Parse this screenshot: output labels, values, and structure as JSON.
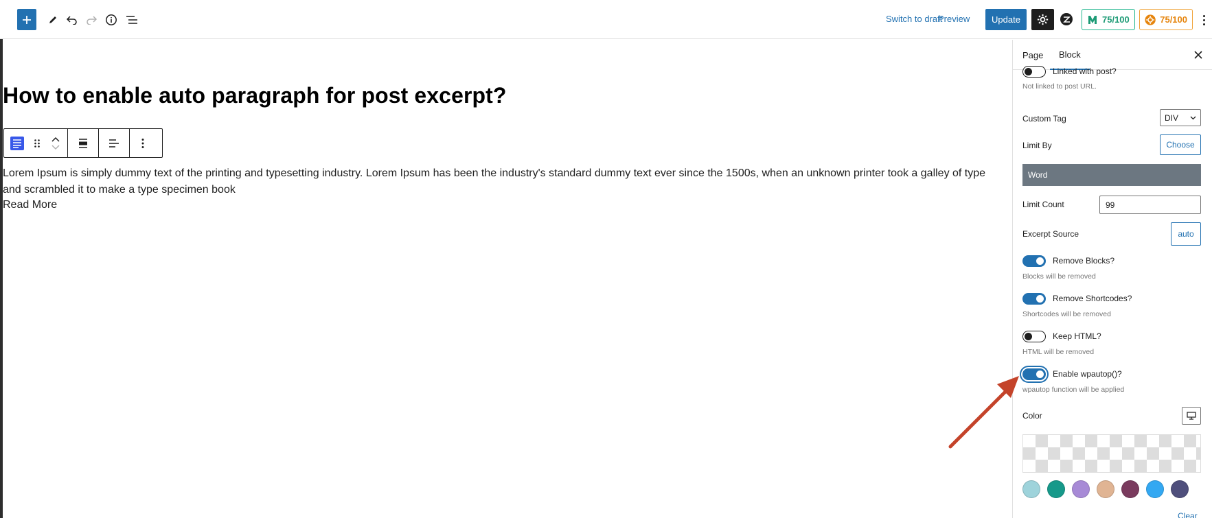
{
  "toolbar": {
    "switch_to_draft": "Switch to draft",
    "preview": "Preview",
    "update": "Update",
    "score_a": "75/100",
    "score_b": "75/100"
  },
  "editor": {
    "title": "How to enable auto paragraph for post excerpt?",
    "excerpt": "Lorem Ipsum is simply dummy text of the printing and typesetting industry. Lorem Ipsum has been the industry's standard dummy text ever since the 1500s, when an unknown printer took a galley of type and scrambled it to make a type specimen book",
    "read_more": "Read More"
  },
  "sidebar": {
    "tabs": [
      {
        "label": "Page",
        "active": false
      },
      {
        "label": "Block",
        "active": true
      }
    ],
    "linked_label": "Linked with post?",
    "linked_help": "Not linked to post URL.",
    "linked_on": false,
    "custom_tag_label": "Custom Tag",
    "custom_tag_value": "DIV",
    "limit_by_label": "Limit By",
    "choose_label": "Choose",
    "limit_by_value": "Word",
    "limit_count_label": "Limit Count",
    "limit_count_value": "99",
    "excerpt_source_label": "Excerpt Source",
    "excerpt_source_value": "auto",
    "remove_blocks_label": "Remove Blocks?",
    "remove_blocks_help": "Blocks will be removed",
    "remove_blocks_on": true,
    "remove_shortcodes_label": "Remove Shortcodes?",
    "remove_shortcodes_help": "Shortcodes will be removed",
    "remove_shortcodes_on": true,
    "keep_html_label": "Keep HTML?",
    "keep_html_help": "HTML will be removed",
    "keep_html_on": false,
    "wpautop_label": "Enable wpautop()?",
    "wpautop_help": "wpautop function will be applied",
    "wpautop_on": true,
    "color_label": "Color",
    "clear_label": "Clear",
    "swatches": [
      "#9ed3db",
      "#16998a",
      "#a78ad6",
      "#e0b493",
      "#7a3b5e",
      "#33a8f2",
      "#4f4f7c"
    ]
  },
  "colors": {
    "accent": "#2271b1",
    "arrow": "#c4432a"
  }
}
